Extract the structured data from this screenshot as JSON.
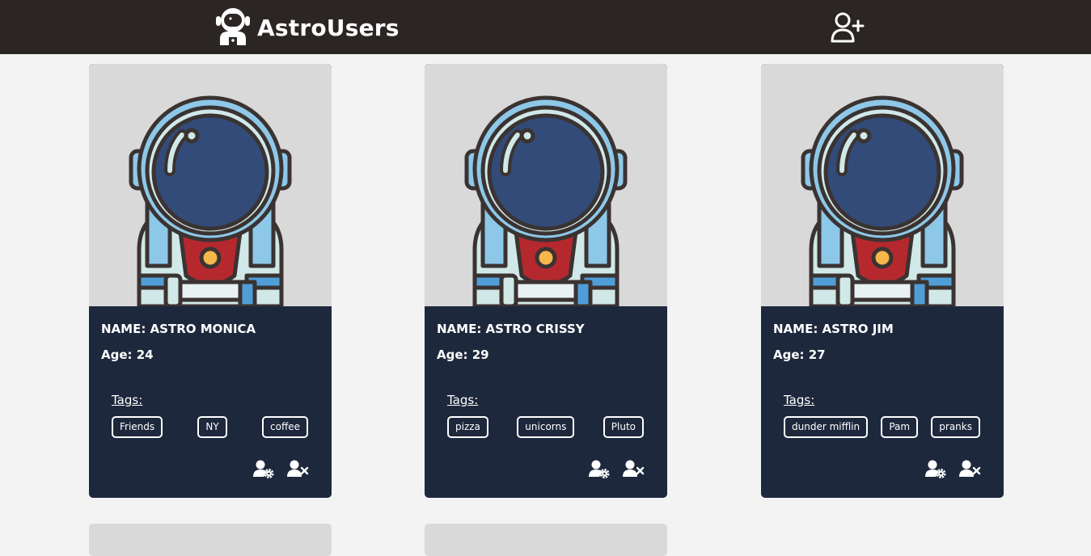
{
  "header": {
    "title": "AstroUsers",
    "logo_icon": "astronaut-icon",
    "add_icon": "add-user-icon"
  },
  "users": [
    {
      "name": "NAME: ASTRO MONICA",
      "age": "Age: 24",
      "tags_label": "Tags:",
      "tags": [
        "Friends",
        "NY",
        "coffee"
      ]
    },
    {
      "name": "NAME: ASTRO CRISSY",
      "age": "Age: 29",
      "tags_label": "Tags:",
      "tags": [
        "pizza",
        "unicorns",
        "Pluto"
      ]
    },
    {
      "name": "NAME: ASTRO JIM",
      "age": "Age: 27",
      "tags_label": "Tags:",
      "tags": [
        "dunder mifflin",
        "Pam",
        "pranks"
      ]
    }
  ],
  "actions": {
    "edit_icon": "user-gear-icon",
    "delete_icon": "user-remove-icon"
  },
  "colors": {
    "header_bg": "#2b2624",
    "page_bg": "#f3f3f3",
    "card_bg": "#1e283d",
    "image_bg": "#d9d9d9",
    "helmet_visor": "#324b78",
    "suit_red": "#b5292e"
  }
}
